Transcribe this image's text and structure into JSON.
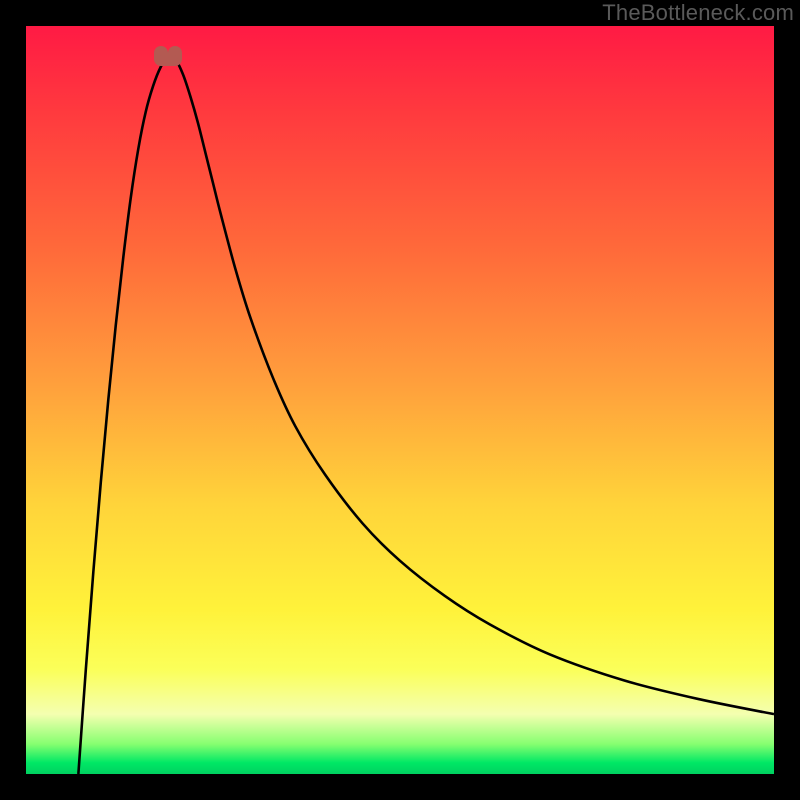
{
  "watermark": "TheBottleneck.com",
  "colors": {
    "curve": "#000000",
    "marker": "#b35a52"
  },
  "chart_data": {
    "type": "line",
    "title": "",
    "xlabel": "",
    "ylabel": "",
    "xlim": [
      0,
      100
    ],
    "ylim": [
      0,
      100
    ],
    "grid": false,
    "legend": false,
    "marker": {
      "x": 19,
      "y": 96
    },
    "series": [
      {
        "name": "bottleneck-curve",
        "x": [
          7,
          8,
          9,
          10,
          11,
          12,
          13,
          14,
          15,
          16,
          17,
          18,
          19,
          20,
          21,
          22,
          23,
          24,
          25,
          26,
          28,
          30,
          33,
          36,
          40,
          45,
          50,
          56,
          62,
          70,
          80,
          90,
          100
        ],
        "y": [
          0,
          14,
          27,
          39,
          50,
          60,
          69,
          77,
          83.5,
          88.5,
          92,
          94.5,
          96,
          95.5,
          93.5,
          90.5,
          87,
          83,
          79,
          75,
          67.5,
          61,
          53,
          46.5,
          40,
          33.5,
          28.5,
          23.8,
          20,
          16,
          12.5,
          10,
          8
        ]
      }
    ]
  }
}
